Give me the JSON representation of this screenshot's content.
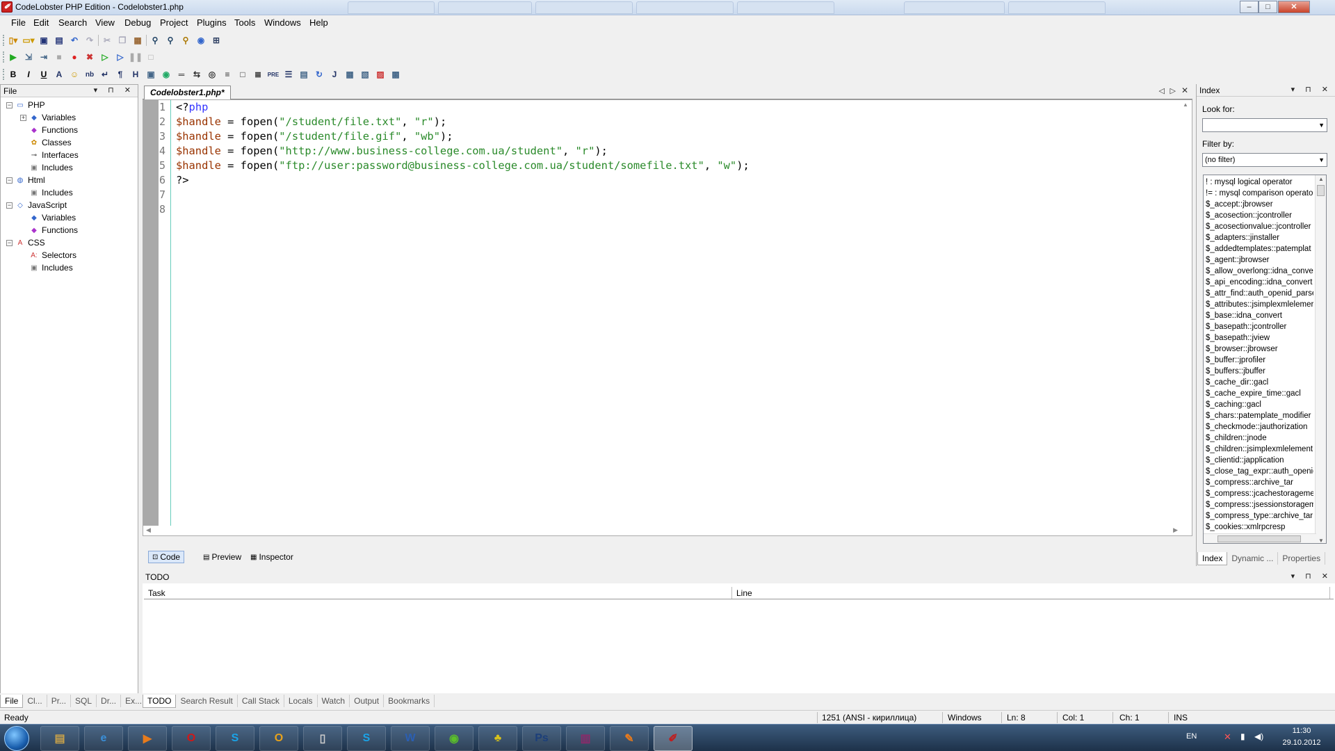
{
  "window": {
    "title": "CodeLobster PHP Edition - Codelobster1.php",
    "app_icon": "codelobster-icon",
    "controls": {
      "minimize": "‒",
      "maximize": "□",
      "close": "✕"
    }
  },
  "menu": {
    "items": [
      "File",
      "Edit",
      "Search",
      "View",
      "Debug",
      "Project",
      "Plugins",
      "Tools",
      "Windows",
      "Help"
    ]
  },
  "toolbar1": {
    "icons": [
      "new-file-icon",
      "open-file-icon",
      "save-icon",
      "save-all-icon",
      "undo-icon",
      "redo-icon",
      "cut-icon",
      "copy-icon",
      "paste-icon",
      "find-icon",
      "find-replace-icon",
      "find-in-files-icon",
      "help-icon",
      "settings-icon"
    ]
  },
  "toolbar2": {
    "icons": [
      "run-icon",
      "step-into-icon",
      "step-over-icon",
      "stop-icon",
      "breakpoint-icon",
      "clear-breakpoints-icon",
      "continue-icon",
      "step-icon",
      "pause-icon",
      "stop-debug-icon"
    ]
  },
  "toolbar3": {
    "labels": [
      "B",
      "I",
      "U",
      "A",
      "☺",
      "nb",
      "↵",
      "¶",
      "H",
      "▣",
      "◉",
      "═",
      "⇆",
      "◎",
      "≡",
      "□",
      "≣",
      "PRE",
      "☰",
      "▤",
      "↻",
      "J",
      "▦",
      "▧",
      "▨",
      "▩"
    ]
  },
  "left_panel": {
    "title": "File",
    "controls": "▾ ⊓ ✕",
    "tree": [
      {
        "label": "PHP",
        "level": 0,
        "expander": "−",
        "icon": "php-icon"
      },
      {
        "label": "Variables",
        "level": 1,
        "expander": "+",
        "icon": "variable-icon"
      },
      {
        "label": "Functions",
        "level": 1,
        "expander": "",
        "icon": "function-icon"
      },
      {
        "label": "Classes",
        "level": 1,
        "expander": "",
        "icon": "class-icon"
      },
      {
        "label": "Interfaces",
        "level": 1,
        "expander": "",
        "icon": "interface-icon"
      },
      {
        "label": "Includes",
        "level": 1,
        "expander": "",
        "icon": "includes-icon"
      },
      {
        "label": "Html",
        "level": 0,
        "expander": "−",
        "icon": "html-icon"
      },
      {
        "label": "Includes",
        "level": 1,
        "expander": "",
        "icon": "includes-icon"
      },
      {
        "label": "JavaScript",
        "level": 0,
        "expander": "−",
        "icon": "javascript-icon"
      },
      {
        "label": "Variables",
        "level": 1,
        "expander": "",
        "icon": "variable-icon"
      },
      {
        "label": "Functions",
        "level": 1,
        "expander": "",
        "icon": "function-icon"
      },
      {
        "label": "CSS",
        "level": 0,
        "expander": "−",
        "icon": "css-icon"
      },
      {
        "label": "Selectors",
        "level": 1,
        "expander": "",
        "icon": "selector-icon"
      },
      {
        "label": "Includes",
        "level": 1,
        "expander": "",
        "icon": "includes-icon"
      }
    ],
    "bottom_tabs": [
      "File",
      "Cl...",
      "Pr...",
      "SQL",
      "Dr...",
      "Ex..."
    ]
  },
  "editor": {
    "tab_label": "Codelobster1.php*",
    "line_numbers": [
      "1",
      "2",
      "3",
      "4",
      "5",
      "6",
      "7",
      "8"
    ],
    "lines": [
      [
        {
          "t": "<?",
          "c": "op"
        },
        {
          "t": "php",
          "c": "kw"
        }
      ],
      [
        {
          "t": "$handle",
          "c": "var"
        },
        {
          "t": " = fopen(",
          "c": "op"
        },
        {
          "t": "\"/student/file.txt\"",
          "c": "str"
        },
        {
          "t": ", ",
          "c": "op"
        },
        {
          "t": "\"r\"",
          "c": "str"
        },
        {
          "t": ");",
          "c": "op"
        }
      ],
      [
        {
          "t": "$handle",
          "c": "var"
        },
        {
          "t": " = fopen(",
          "c": "op"
        },
        {
          "t": "\"/student/file.gif\"",
          "c": "str"
        },
        {
          "t": ", ",
          "c": "op"
        },
        {
          "t": "\"wb\"",
          "c": "str"
        },
        {
          "t": ");",
          "c": "op"
        }
      ],
      [
        {
          "t": "$handle",
          "c": "var"
        },
        {
          "t": " = fopen(",
          "c": "op"
        },
        {
          "t": "\"http://www.business-college.com.ua/student\"",
          "c": "str"
        },
        {
          "t": ", ",
          "c": "op"
        },
        {
          "t": "\"r\"",
          "c": "str"
        },
        {
          "t": ");",
          "c": "op"
        }
      ],
      [
        {
          "t": "$handle",
          "c": "var"
        },
        {
          "t": " = fopen(",
          "c": "op"
        },
        {
          "t": "\"ftp://user:password@business-college.com.ua/student/somefile.txt\"",
          "c": "str"
        },
        {
          "t": ", ",
          "c": "op"
        },
        {
          "t": "\"w\"",
          "c": "str"
        },
        {
          "t": ");",
          "c": "op"
        }
      ],
      [
        {
          "t": "?>",
          "c": "op"
        }
      ],
      [],
      []
    ],
    "view_tabs": [
      "Code",
      "Preview",
      "Inspector"
    ]
  },
  "right_panel": {
    "title": "Index",
    "look_for_label": "Look for:",
    "look_for_value": "",
    "filter_label": "Filter by:",
    "filter_value": "(no filter)",
    "items": [
      "! : mysql logical operator",
      "!= : mysql comparison operato",
      "$_accept::jbrowser",
      "$_acosection::jcontroller",
      "$_acosectionvalue::jcontroller",
      "$_adapters::jinstaller",
      "$_addedtemplates::patemplat",
      "$_agent::jbrowser",
      "$_allow_overlong::idna_conver",
      "$_api_encoding::idna_convert",
      "$_attr_find::auth_openid_parse",
      "$_attributes::jsimplexmlelemer",
      "$_base::idna_convert",
      "$_basepath::jcontroller",
      "$_basepath::jview",
      "$_browser::jbrowser",
      "$_buffer::jprofiler",
      "$_buffers::jbuffer",
      "$_cache_dir::gacl",
      "$_cache_expire_time::gacl",
      "$_caching::gacl",
      "$_chars::patemplate_modifier",
      "$_checkmode::jauthorization",
      "$_children::jnode",
      "$_children::jsimplexmlelement",
      "$_clientid::japplication",
      "$_close_tag_expr::auth_openid",
      "$_compress::archive_tar",
      "$_compress::jcachestorageme",
      "$_compress::jsessionstoragem",
      "$_compress_type::archive_tar",
      "$_cookies::xmlrpcresp"
    ],
    "tabs": [
      "Index",
      "Dynamic ...",
      "Properties"
    ]
  },
  "todo_panel": {
    "title": "TODO",
    "columns": [
      "Task",
      "Line"
    ],
    "bottom_tabs": [
      "TODO",
      "Search Result",
      "Call Stack",
      "Locals",
      "Watch",
      "Output",
      "Bookmarks"
    ]
  },
  "statusbar": {
    "ready": "Ready",
    "encoding": "1251 (ANSI - кириллица)",
    "line_ending": "Windows",
    "ln": "Ln: 8",
    "col": "Col: 1",
    "ch": "Ch: 1",
    "mode": "INS"
  },
  "taskbar": {
    "apps": [
      "explorer-icon",
      "internet-explorer-icon",
      "media-player-icon",
      "opera-icon",
      "skype-icon",
      "outlook-icon",
      "files-icon",
      "skype-icon",
      "word-icon",
      "green-app-icon",
      "robot-app-icon",
      "photoshop-icon",
      "winrar-icon",
      "sublime-icon",
      "codelobster-icon"
    ],
    "app_glyphs": [
      "▤",
      "e",
      "▶",
      "O",
      "S",
      "O",
      "▯",
      "S",
      "W",
      "◉",
      "♣",
      "Ps",
      "▥",
      "✎",
      "✐"
    ],
    "lang": "EN",
    "time": "11:30",
    "date": "29.10.2012"
  }
}
